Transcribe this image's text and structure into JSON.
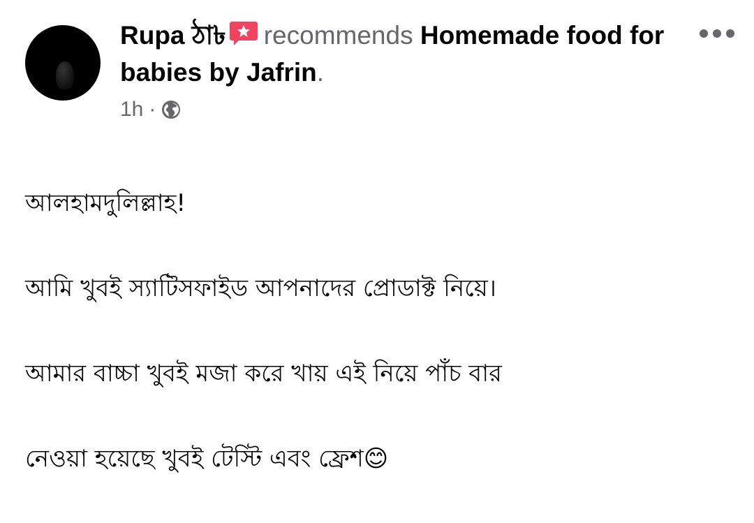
{
  "post": {
    "author_name": "Rupa ঠা৳",
    "recommend_icon": "recommend-star-speech-icon",
    "verb": "recommends",
    "page_name": "Homemade food for babies by Jafrin",
    "period": ".",
    "time": "1h",
    "separator": "·",
    "privacy_icon": "globe-icon",
    "more_icon": "more-options-icon",
    "lines": [
      "আলহামদুলিল্লাহ!",
      "আমি খুবই স্যাটিসফাইড আপনাদের প্রোডাক্ট নিয়ে।",
      "আমার বাচ্চা খুবই মজা করে খায় এই নিয়ে পাঁচ বার",
      "নেওয়া হয়েছে খুবই টেস্টি এবং ফ্রেশ😊"
    ]
  },
  "colors": {
    "primary_text": "#050505",
    "secondary_text": "#65676b",
    "recommend_icon": "#f3425f"
  }
}
